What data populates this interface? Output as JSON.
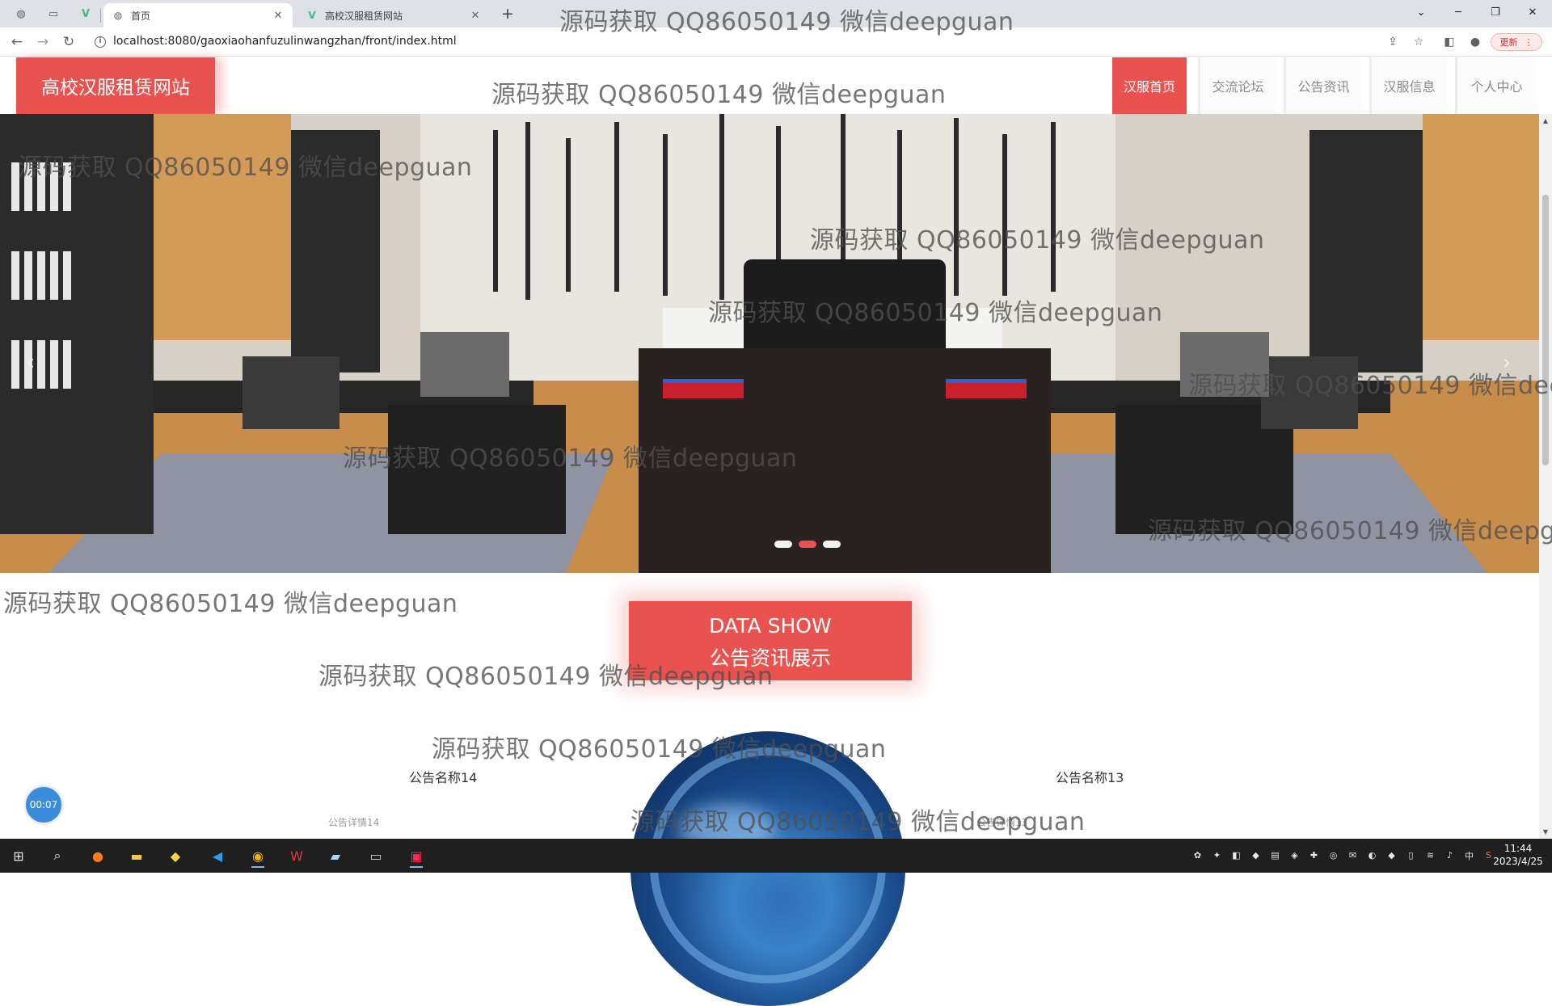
{
  "browser": {
    "tabs": [
      {
        "title": "首页",
        "active": true
      },
      {
        "title": "高校汉服租赁网站",
        "active": false
      }
    ],
    "url": "localhost:8080/gaoxiaohanfuzulinwangzhan/front/index.html",
    "update_label": "更新"
  },
  "site": {
    "logo": "高校汉服租赁网站",
    "nav": [
      {
        "label": "汉服首页",
        "active": true
      },
      {
        "label": "交流论坛",
        "active": false
      },
      {
        "label": "公告资讯",
        "active": false
      },
      {
        "label": "汉服信息",
        "active": false
      },
      {
        "label": "个人中心",
        "active": false
      }
    ],
    "accent_color": "#e9524f"
  },
  "carousel": {
    "slide_count": 3,
    "active_index": 1
  },
  "section": {
    "title_en": "DATA SHOW",
    "title_cn": "公告资讯展示"
  },
  "news": [
    {
      "title": "公告名称14",
      "desc": "公告详情14"
    },
    {
      "title": "公告名称13",
      "desc": "公告详情13"
    }
  ],
  "timer": "00:07",
  "watermark": "源码获取 QQ86050149 微信deepguan",
  "taskbar": {
    "time": "11:44",
    "date": "2023/4/25",
    "ime": "中"
  }
}
